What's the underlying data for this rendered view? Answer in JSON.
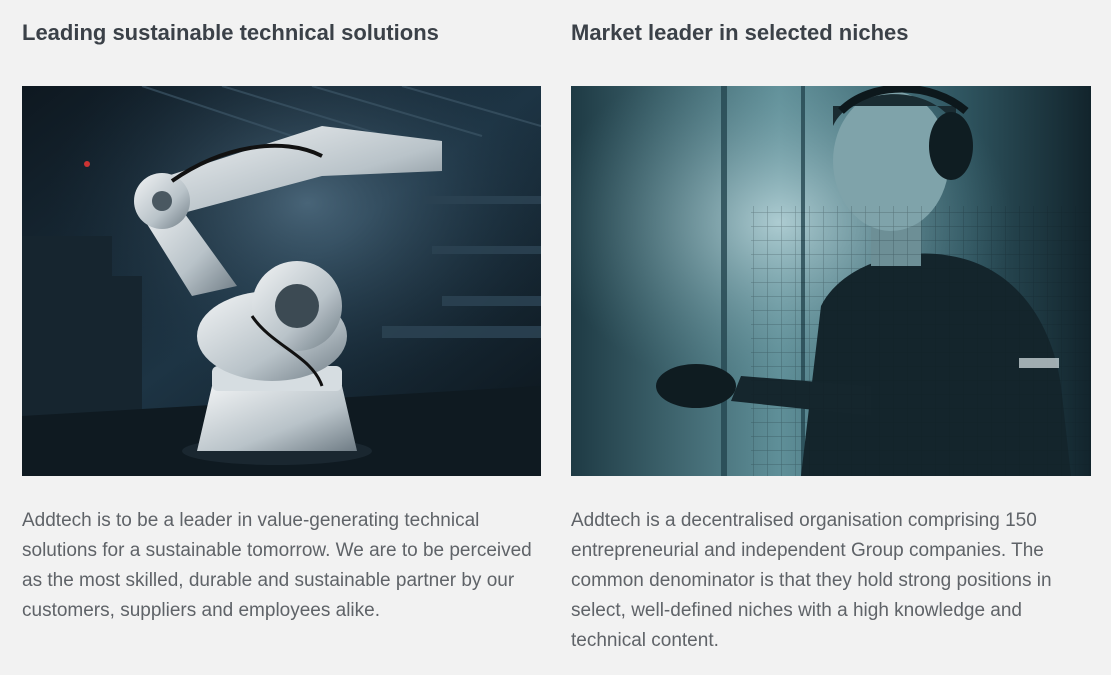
{
  "sections": [
    {
      "heading": "Leading sustainable technical solutions",
      "image_subject": "industrial-robot-arm",
      "body": "Addtech is to be a leader in value-generating technical solutions for a sustainable tomorrow. We are to be perceived as the most skilled, durable and sustainable partner by our customers, suppliers and employees alike."
    },
    {
      "heading": "Market leader in selected niches",
      "image_subject": "technician-with-headset",
      "body": "Addtech is a decentralised organisation comprising 150 entrepreneurial and independent Group companies. The common denominator is that they hold strong positions in select, well-defined niches with a high knowledge and technical content."
    }
  ],
  "colors": {
    "background": "#f2f2f2",
    "heading": "#3b4148",
    "body_text": "#5f6368"
  }
}
